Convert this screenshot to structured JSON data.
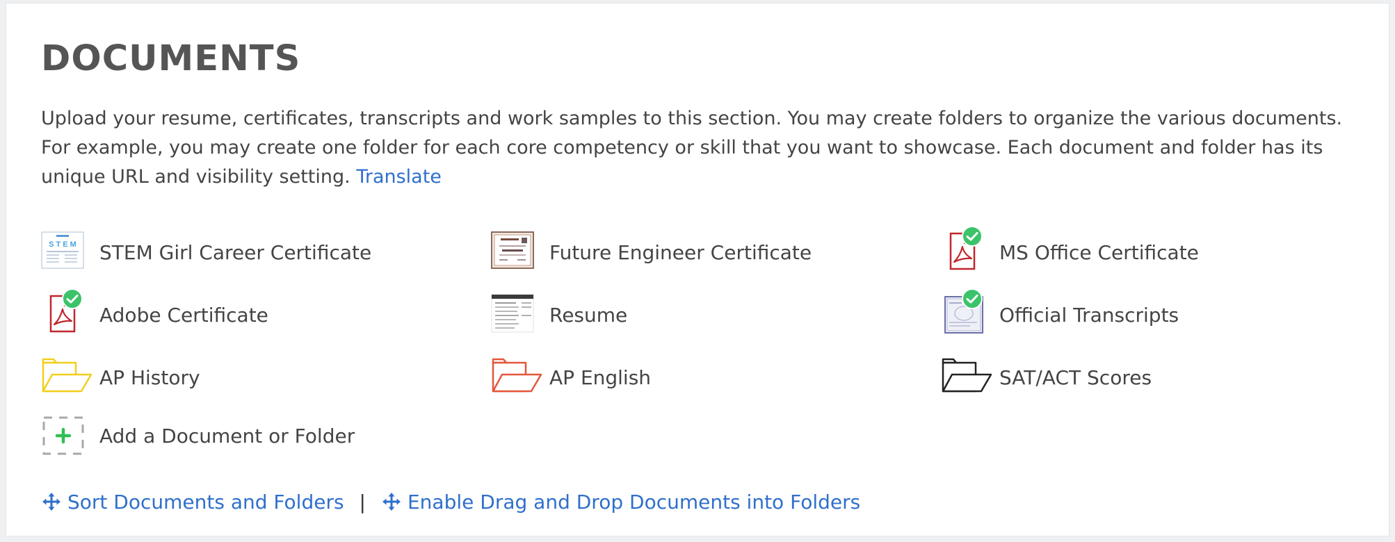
{
  "section": {
    "title": "DOCUMENTS",
    "description": "Upload your resume, certificates, transcripts and work samples to this section. You may create folders to organize the various documents. For example, you may create one folder for each core competency or skill that you want to showcase. Each document and folder has its unique URL and visibility setting.",
    "translate_label": "Translate"
  },
  "items": [
    {
      "label": "STEM Girl Career Certificate",
      "icon": "certificate-thumbnail-icon",
      "verified": false
    },
    {
      "label": "Future Engineer Certificate",
      "icon": "certificate-thumbnail-icon",
      "verified": false
    },
    {
      "label": "MS Office Certificate",
      "icon": "pdf-icon",
      "verified": true
    },
    {
      "label": "Adobe Certificate",
      "icon": "pdf-icon",
      "verified": true
    },
    {
      "label": "Resume",
      "icon": "document-thumbnail-icon",
      "verified": false
    },
    {
      "label": "Official Transcripts",
      "icon": "transcript-thumbnail-icon",
      "verified": true
    },
    {
      "label": "AP History",
      "icon": "folder-icon",
      "color": "#f2cf1d"
    },
    {
      "label": "AP English",
      "icon": "folder-icon",
      "color": "#e4563b"
    },
    {
      "label": "SAT/ACT Scores",
      "icon": "folder-icon",
      "color": "#222222"
    }
  ],
  "add_item": {
    "label": "Add a Document or Folder",
    "icon": "add-icon"
  },
  "actions": {
    "sort_label": "Sort Documents and Folders",
    "separator": "|",
    "drag_drop_label": "Enable Drag and Drop Documents into Folders"
  },
  "colors": {
    "link": "#2f6fcb",
    "verified": "#3cc36a",
    "pdf": "#c0262c",
    "add_plus": "#2fbf55"
  }
}
